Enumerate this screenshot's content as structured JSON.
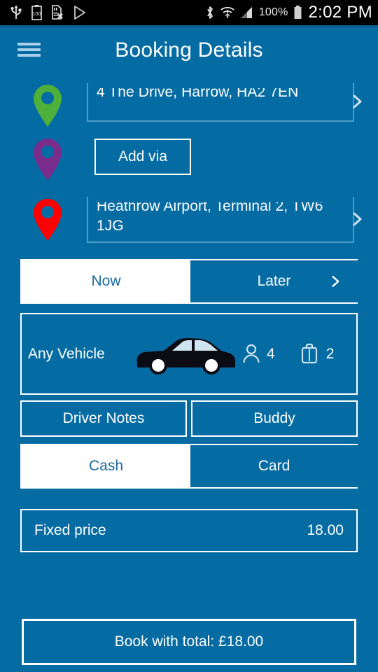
{
  "statusbar": {
    "icons_left": [
      "usb-icon",
      "battery-100-icon",
      "sdcard-error-icon",
      "play-store-icon"
    ],
    "icons_right": [
      "bluetooth-icon",
      "wifi-icon",
      "cell-signal-icon"
    ],
    "battery_percent": "100%",
    "time": "2:02 PM"
  },
  "header": {
    "menu_icon": "hamburger-menu-icon",
    "title": "Booking Details"
  },
  "colors": {
    "background": "#056ba3",
    "accent_white": "#ffffff",
    "selected_text": "#1a6a9e",
    "pickup_pin": "#4cb03a",
    "via_pin": "#7b2d8e",
    "dropoff_pin": "#ff0000",
    "field_underline": "#4d9ec6"
  },
  "journey": {
    "pickup": {
      "pin_icon": "map-pin-green-icon",
      "address": "4 The Drive, Harrow, HA2 7EN",
      "chevron_icon": "chevron-right-icon"
    },
    "via": {
      "pin_icon": "map-pin-purple-icon",
      "add_via_label": "Add via"
    },
    "dropoff": {
      "pin_icon": "map-pin-red-icon",
      "address": "Heathrow Airport, Terminal 2, TW6 1JG",
      "chevron_icon": "chevron-right-icon"
    }
  },
  "time_toggle": {
    "options": [
      "Now",
      "Later"
    ],
    "now_label": "Now",
    "later_label": "Later",
    "selected": "Now",
    "later_chevron_icon": "chevron-right-icon"
  },
  "vehicle": {
    "label": "Any Vehicle",
    "car_icon": "sedan-car-icon",
    "passenger_icon": "person-icon",
    "passengers": "4",
    "luggage_icon": "suitcase-icon",
    "luggage": "2"
  },
  "extras": {
    "driver_notes_label": "Driver Notes",
    "buddy_label": "Buddy"
  },
  "payment_toggle": {
    "options": [
      "Cash",
      "Card"
    ],
    "cash_label": "Cash",
    "card_label": "Card",
    "selected": "Cash"
  },
  "price": {
    "label": "Fixed price",
    "amount": "18.00"
  },
  "book": {
    "label": "Book with total: £18.00"
  }
}
